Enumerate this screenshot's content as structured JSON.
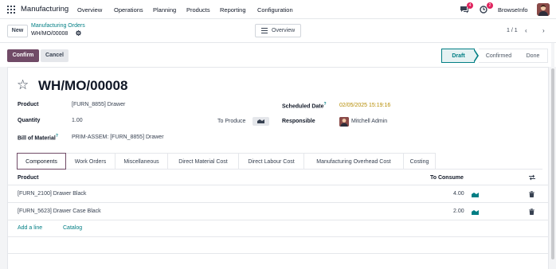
{
  "app": {
    "brand": "Manufacturing",
    "menu": [
      "Overview",
      "Operations",
      "Planning",
      "Products",
      "Reporting",
      "Configuration"
    ],
    "chat_badge": "4",
    "activity_badge": "2",
    "company": "BrowseInfo"
  },
  "control": {
    "new_label": "New",
    "breadcrumb_parent": "Manufacturing Orders",
    "breadcrumb_current": "WH/MO/00008",
    "overview_label": "Overview",
    "pager": "1 / 1"
  },
  "actions": {
    "confirm_label": "Confirm",
    "cancel_label": "Cancel"
  },
  "status": {
    "steps": [
      "Draft",
      "Confirmed",
      "Done"
    ],
    "active": "Draft"
  },
  "form": {
    "title": "WH/MO/00008",
    "product_label": "Product",
    "product_value": "[FURN_8855] Drawer",
    "quantity_label": "Quantity",
    "quantity_value": "1.00",
    "to_produce_label": "To Produce",
    "bom_label": "Bill of Material",
    "bom_help": "?",
    "bom_value": "PRIM-ASSEM: [FURN_8855] Drawer",
    "scheduled_label": "Scheduled Date",
    "scheduled_help": "?",
    "scheduled_value": "02/05/2025 15:19:16",
    "responsible_label": "Responsible",
    "responsible_value": "Mitchell Admin"
  },
  "tabs": [
    "Components",
    "Work Orders",
    "Miscellaneous",
    "Direct Material Cost",
    "Direct Labour Cost",
    "Manufacturing Overhead Cost",
    "Costing"
  ],
  "active_tab": "Components",
  "components": {
    "col_product": "Product",
    "col_to_consume": "To Consume",
    "rows": [
      {
        "product": "[FURN_2100] Drawer Black",
        "to_consume": "4.00"
      },
      {
        "product": "[FURN_5623] Drawer Case Black",
        "to_consume": "2.00"
      }
    ],
    "add_line": "Add a line",
    "catalog": "Catalog"
  },
  "colors": {
    "primary": "#714b67",
    "accent": "#017e84",
    "badge": "#e0245e",
    "date_warning": "#b58b00"
  }
}
